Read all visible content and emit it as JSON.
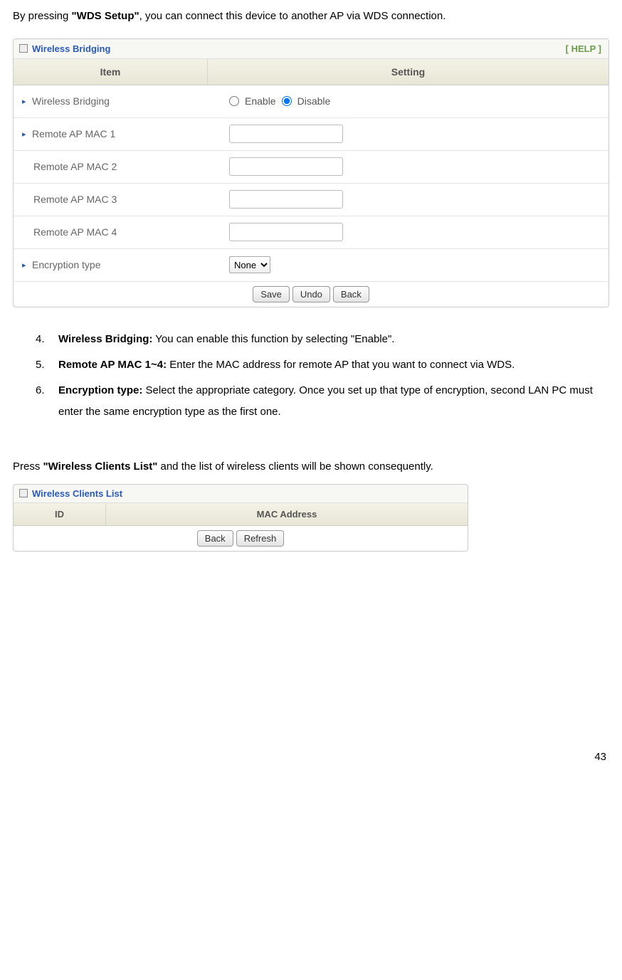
{
  "intro": {
    "prefix": "By pressing ",
    "bold": "\"WDS Setup\"",
    "suffix": ", you can connect this device to another AP via WDS connection."
  },
  "panel1": {
    "title": "Wireless Bridging",
    "help": "[ HELP ]",
    "headers": {
      "item": "Item",
      "setting": "Setting"
    },
    "rows": {
      "bridging_label": "Wireless Bridging",
      "enable_label": "Enable",
      "disable_label": "Disable",
      "mac1_label": "Remote AP MAC  1",
      "mac2_label": "Remote AP MAC  2",
      "mac3_label": "Remote AP MAC  3",
      "mac4_label": "Remote AP MAC  4",
      "encryption_label": "Encryption type",
      "encryption_value": "None"
    },
    "buttons": {
      "save": "Save",
      "undo": "Undo",
      "back": "Back"
    }
  },
  "list": {
    "item4": {
      "num": "4.",
      "bold": "Wireless Bridging:",
      "text": " You can enable this function by selecting \"Enable\"."
    },
    "item5": {
      "num": "5.",
      "bold": "Remote AP MAC 1~4:",
      "text": " Enter the MAC address for remote AP that you want to connect via WDS."
    },
    "item6": {
      "num": "6.",
      "bold": "Encryption type:",
      "text": " Select the appropriate category. Once you set up that type of encryption, second LAN PC must enter the same encryption type as the first one."
    }
  },
  "press": {
    "prefix": "Press ",
    "bold": "\"Wireless Clients List\"",
    "suffix": " and the list of wireless clients will be shown consequently."
  },
  "panel2": {
    "title": "Wireless Clients List",
    "headers": {
      "id": "ID",
      "mac": "MAC Address"
    },
    "buttons": {
      "back": "Back",
      "refresh": "Refresh"
    }
  },
  "page_number": "43"
}
